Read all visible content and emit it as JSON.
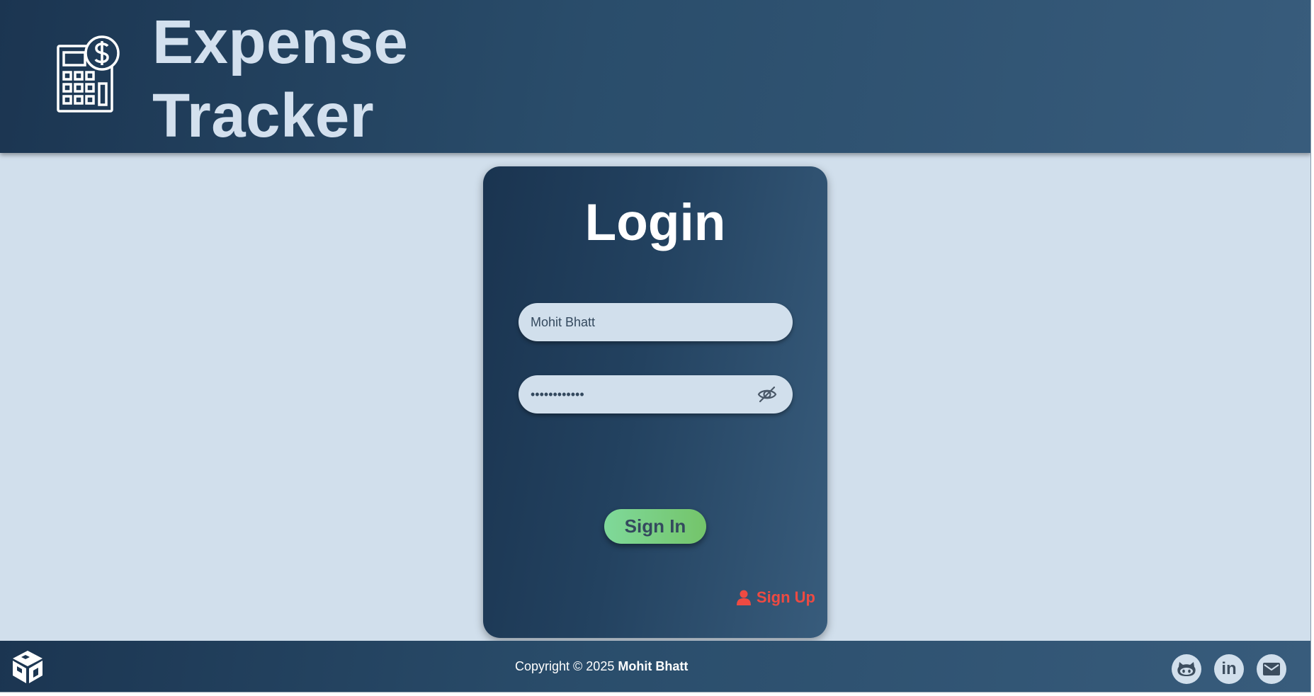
{
  "header": {
    "title": "Expense Tracker",
    "logo_icon": "calculator-dollar-icon"
  },
  "login": {
    "title": "Login",
    "username_value": "Mohit Bhatt",
    "password_value": "••••••••••••",
    "password_toggle_icon": "eye-slash-icon",
    "signin_label": "Sign In",
    "signup_label": "Sign Up",
    "signup_icon": "user-icon"
  },
  "footer": {
    "copyright_prefix": "Copyright © 2025",
    "copyright_name": "Mohit Bhatt",
    "logo_icon": "cube-logo-icon",
    "social": [
      {
        "name": "github",
        "icon": "github-icon"
      },
      {
        "name": "linkedin",
        "icon": "linkedin-icon",
        "text": "in"
      },
      {
        "name": "mail",
        "icon": "mail-icon"
      }
    ]
  },
  "colors": {
    "header_dark": "#1b3551",
    "header_light": "#385c7c",
    "background": "#d1dfec",
    "title_text": "#d3e0ee",
    "button_green": "#7fd99a",
    "signup_red": "#ee4a42",
    "field_text": "#34495e"
  }
}
